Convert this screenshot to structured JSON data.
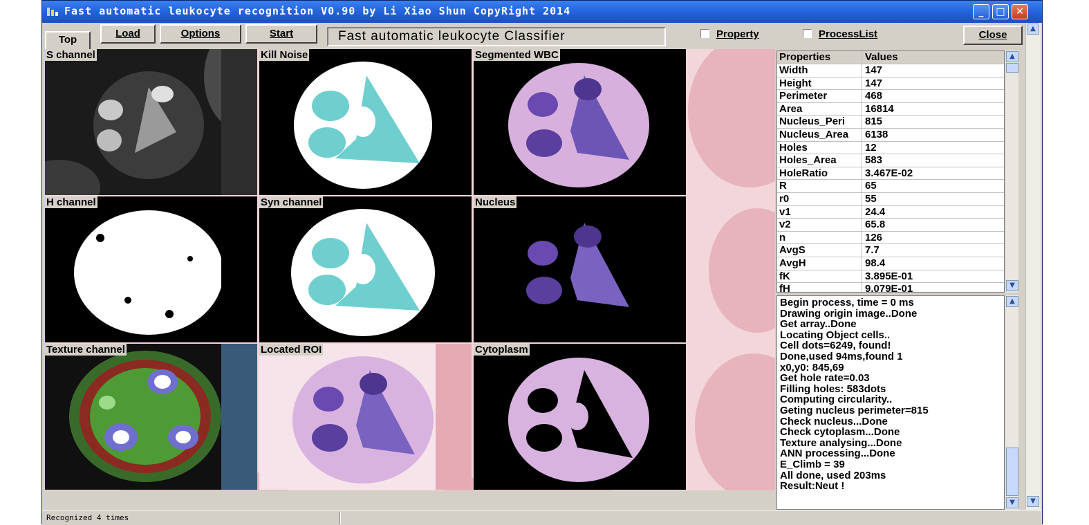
{
  "window": {
    "title": "Fast  automatic  leukocyte  recognition  V0.90  by  Li  Xiao  Shun   CopyRight  2014",
    "minimize": "_",
    "maximize": "□",
    "close": "✕"
  },
  "toolbar": {
    "top_tab": "Top",
    "load": "Load",
    "options": "Options",
    "start": "Start",
    "app_name": "Fast automatic leukocyte Classifier",
    "property_label": "Property",
    "processlist_label": "ProcessList",
    "close_label": "Close"
  },
  "panels": [
    {
      "label": "S channel"
    },
    {
      "label": "Kill Noise"
    },
    {
      "label": "Segmented WBC"
    },
    {
      "label": "H channel"
    },
    {
      "label": "Syn channel"
    },
    {
      "label": "Nucleus"
    },
    {
      "label": "Texture channel"
    },
    {
      "label": "Located ROI"
    },
    {
      "label": "Cytoplasm"
    }
  ],
  "properties": {
    "headers": [
      "Properties",
      "Values"
    ],
    "rows": [
      [
        "Width",
        "147"
      ],
      [
        "Height",
        "147"
      ],
      [
        "Perimeter",
        "468"
      ],
      [
        "Area",
        "16814"
      ],
      [
        "Nucleus_Peri",
        "815"
      ],
      [
        "Nucleus_Area",
        "6138"
      ],
      [
        "Holes",
        "12"
      ],
      [
        "Holes_Area",
        "583"
      ],
      [
        "HoleRatio",
        "3.467E-02"
      ],
      [
        "R",
        "65"
      ],
      [
        "r0",
        "55"
      ],
      [
        "v1",
        "24.4"
      ],
      [
        "v2",
        "65.8"
      ],
      [
        "n",
        "126"
      ],
      [
        "AvgS",
        "7.7"
      ],
      [
        "AvgH",
        "98.4"
      ],
      [
        "fK",
        "3.895E-01"
      ],
      [
        "fH",
        "9.079E-01"
      ]
    ]
  },
  "log": [
    "Begin process, time = 0 ms",
    "Drawing origin image..Done",
    "Get array..Done",
    "Locating Object cells..",
    "Cell dots=6249, found!",
    "Done,used 94ms,found 1",
    "x0,y0: 845,69",
    "Get hole rate=0.03",
    "Filling holes: 583dots",
    "Computing circularity..",
    "Geting nucleus perimeter=815",
    "Check nucleus...Done",
    "Check cytoplasm...Done",
    "Texture analysing...Done",
    "ANN processing...Done",
    "E_Climb = 39",
    "All done, used 203ms",
    "Result:Neut !"
  ],
  "status": {
    "text": "Recognized 4 times"
  },
  "colors": {
    "titlebar": "#2363d9",
    "cyan_mask": "#6fcfcf",
    "nucleus_purple": "#5a3f9e",
    "cytoplasm_pink": "#d9b3e0",
    "rbc_pink": "#e7b3bd"
  }
}
